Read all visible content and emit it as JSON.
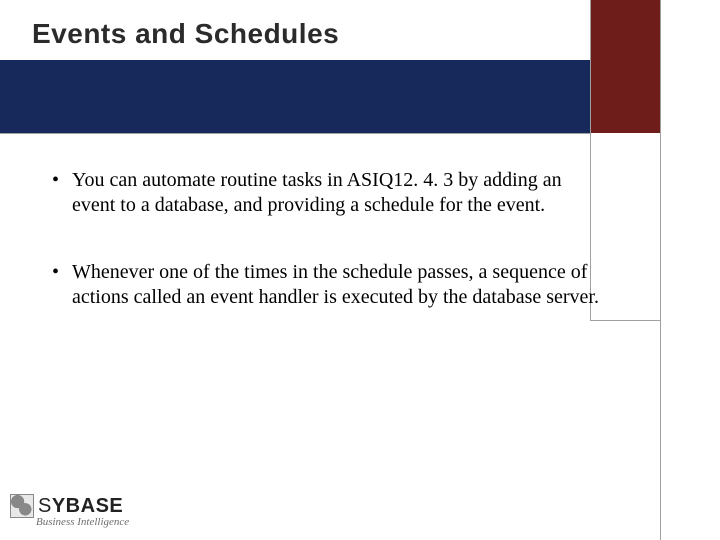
{
  "header": {
    "title": "Events and Schedules"
  },
  "bullets": [
    "You can automate routine tasks in ASIQ12. 4. 3 by adding an event to a database, and providing a schedule for the event.",
    "Whenever one of the times in the schedule passes, a sequence of actions called an event handler is executed by the database server."
  ],
  "logo": {
    "brand_thin": "S",
    "brand_heavy": "YBASE",
    "tagline": "Business Intelligence"
  }
}
